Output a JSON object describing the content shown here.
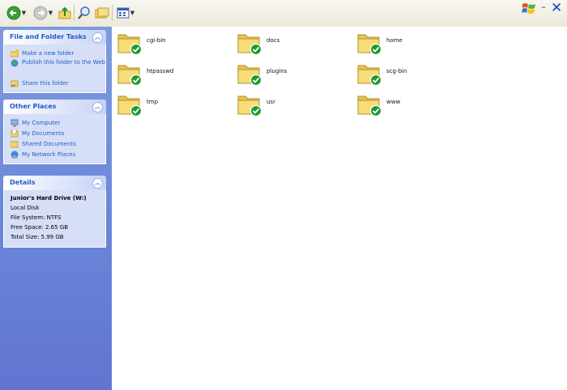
{
  "toolbar": {
    "buttons": [
      "back-icon",
      "forward-icon",
      "up-folder-icon",
      "search-icon",
      "folders-icon",
      "views-icon"
    ]
  },
  "sidebar": {
    "file_tasks": {
      "title": "File and Folder Tasks",
      "items": [
        {
          "label": "Make a new folder",
          "icon": "new-folder-icon"
        },
        {
          "label": "Publish this folder to the Web",
          "icon": "publish-web-icon"
        },
        {
          "label": "Share this folder",
          "icon": "share-folder-icon"
        }
      ]
    },
    "other_places": {
      "title": "Other Places",
      "items": [
        {
          "label": "My Computer",
          "icon": "my-computer-icon"
        },
        {
          "label": "My Documents",
          "icon": "my-documents-icon"
        },
        {
          "label": "Shared Documents",
          "icon": "shared-documents-icon"
        },
        {
          "label": "My Network Places",
          "icon": "network-places-icon"
        }
      ]
    },
    "details": {
      "title": "Details",
      "name": "Junior's Hard Drive (W:)",
      "type": "Local Disk",
      "file_system": "File System: NTFS",
      "free_space": "Free Space: 2.65 GB",
      "total_size": "Total Size: 5.99 GB"
    }
  },
  "folders": [
    {
      "name": "cgi-bin"
    },
    {
      "name": "docs"
    },
    {
      "name": "home"
    },
    {
      "name": "htpasswd"
    },
    {
      "name": "plugins"
    },
    {
      "name": "scg-bin"
    },
    {
      "name": "tmp"
    },
    {
      "name": "usr"
    },
    {
      "name": "www"
    }
  ],
  "colors": {
    "sidebar": "#7c9bde",
    "panel_body": "#d6dff7",
    "link": "#215dc6",
    "folder": "#f5d86a",
    "check": "#1e9a2a"
  }
}
